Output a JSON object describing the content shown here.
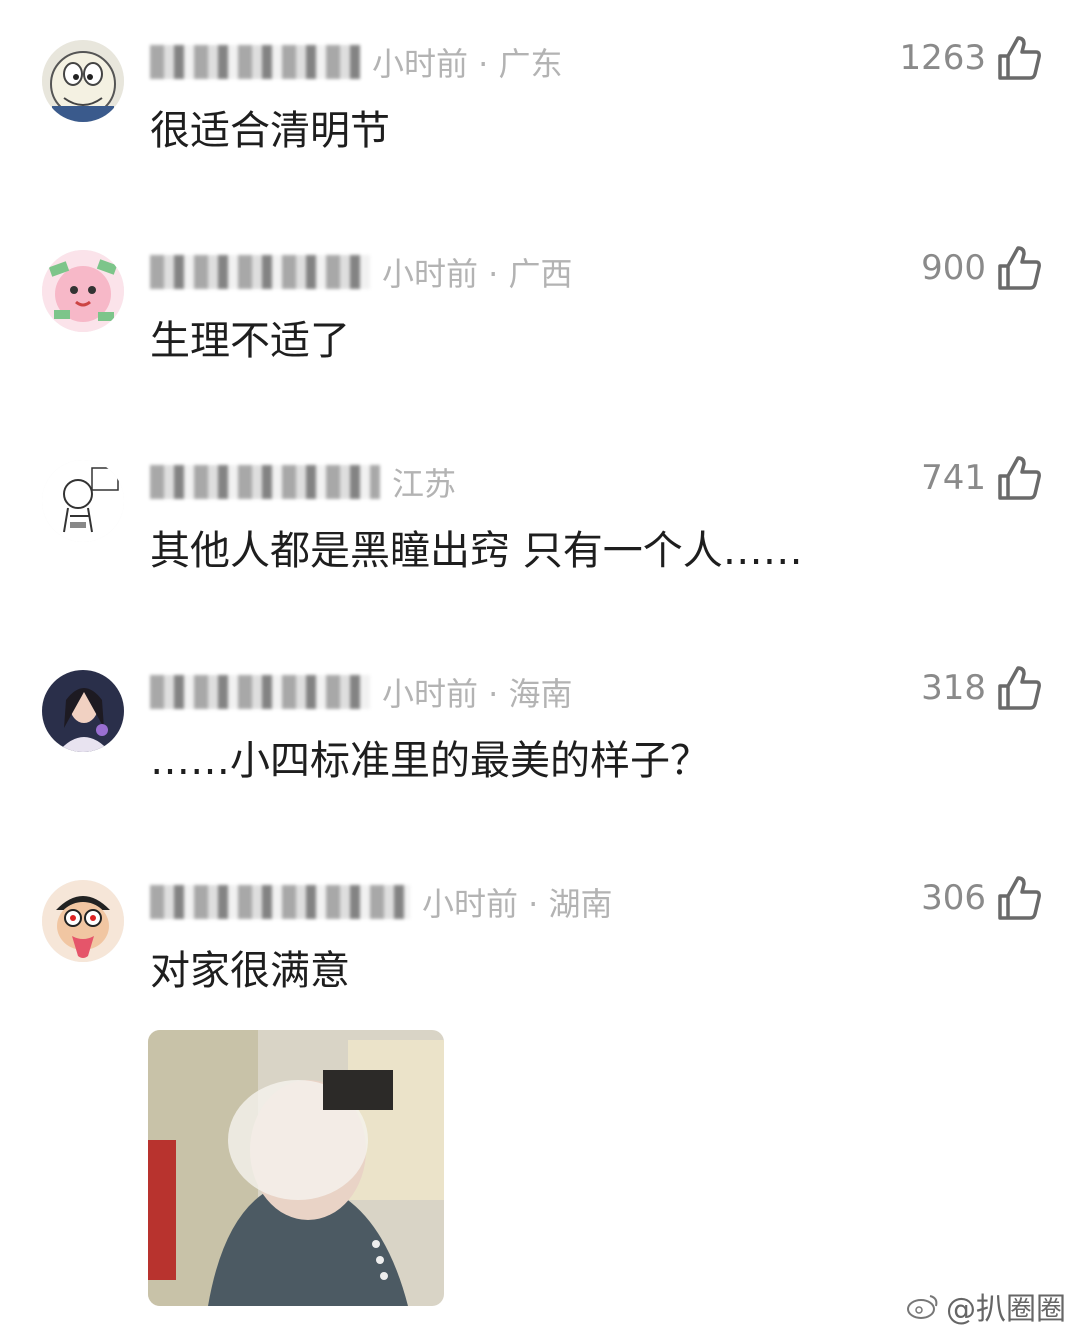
{
  "comments": [
    {
      "meta_suffix": "小时前 · 广东",
      "likes": "1263",
      "text": "很适合清明节",
      "avatar": "doraemon-avatar"
    },
    {
      "meta_suffix": "小时前 · 广西",
      "likes": "900",
      "text": "生理不适了",
      "avatar": "pink-cartoon-avatar"
    },
    {
      "meta_suffix": "江苏",
      "likes": "741",
      "text": "其他人都是黑瞳出窍 只有一个人……",
      "avatar": "sketch-cartoon-avatar"
    },
    {
      "meta_suffix": "小时前 · 海南",
      "likes": "318",
      "text": "……小四标准里的最美的样子？",
      "avatar": "girl-photo-avatar"
    },
    {
      "meta_suffix": "小时前 · 湖南",
      "likes": "306",
      "text": "对家很满意",
      "avatar": "funny-face-avatar"
    }
  ],
  "watermark": "@扒圈圈",
  "colors": {
    "text": "#1e1e1e",
    "meta": "#b3b3b3",
    "likes": "#8a8a8a"
  }
}
